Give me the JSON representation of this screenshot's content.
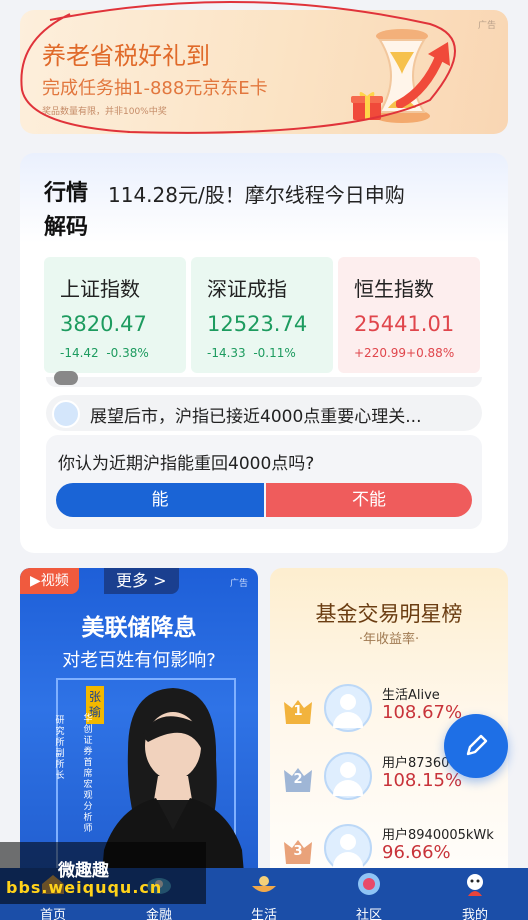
{
  "banner": {
    "title": "养老省税好礼到",
    "subtitle": "完成任务抽1-888元京东E卡",
    "note": "奖品数量有限，并非100%中奖",
    "ad_label": "广告"
  },
  "market": {
    "title": "行情解码",
    "headline": "114.28元/股！摩尔线程今日申购",
    "indices": [
      {
        "name": "上证指数",
        "value": "3820.47",
        "change": "-14.42",
        "change_pct": "-0.38%",
        "trend": "down"
      },
      {
        "name": "深证成指",
        "value": "12523.74",
        "change": "-14.33",
        "change_pct": "-0.11%",
        "trend": "down"
      },
      {
        "name": "恒生指数",
        "value": "25441.01",
        "change": "+220.99",
        "change_pct": "+0.88%",
        "trend": "up"
      }
    ],
    "news_text": "展望后市，沪指已接近4000点重要心理关...",
    "poll": {
      "question": "你认为近期沪指能重回4000点吗?",
      "yes_label": "能",
      "no_label": "不能"
    },
    "colors": {
      "down": "#1d9b5f",
      "up": "#e0464c",
      "yes": "#1a64d6",
      "no": "#ef5c5c"
    }
  },
  "video_card": {
    "tag": "▶视频",
    "more": "更多 >",
    "ad_label": "广告",
    "headline": "美联储降息",
    "subheadline": "对老百姓有何影响?",
    "speaker_name": "张瑜",
    "speaker_title_1": "华创证券首席宏观分析师",
    "speaker_title_2": "研究所副所长"
  },
  "fund_rank": {
    "title": "基金交易明星榜",
    "subtitle": "·年收益率·",
    "entries": [
      {
        "rank": "1",
        "user": "生活Alive",
        "return": "108.67%"
      },
      {
        "rank": "2",
        "user": "用户873600",
        "return": "108.15%"
      },
      {
        "rank": "3",
        "user": "用户8940005kWk",
        "return": "96.66%"
      }
    ]
  },
  "tabbar": {
    "items": [
      {
        "label": "首页"
      },
      {
        "label": "金融"
      },
      {
        "label": "生活"
      },
      {
        "label": "社区"
      },
      {
        "label": "我的"
      }
    ]
  },
  "watermark": {
    "line1": "微趣趣",
    "line2": "bbs.weiququ.cn"
  }
}
